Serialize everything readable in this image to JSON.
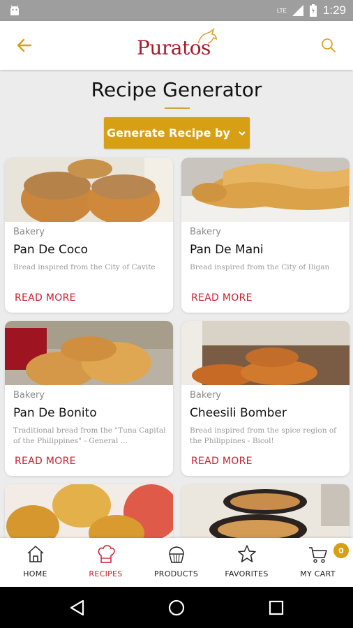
{
  "status_bar": {
    "time": "1:29",
    "network": "LTE"
  },
  "app_bar": {
    "logo": "Puratos"
  },
  "page": {
    "title": "Recipe Generator",
    "generate_button": "Generate Recipe by"
  },
  "recipes": [
    {
      "category": "Bakery",
      "name": "Pan De Coco",
      "description": "Bread inspired from the City of Cavite",
      "action": "READ MORE"
    },
    {
      "category": "Bakery",
      "name": "Pan De Mani",
      "description": "Bread inspired from the City of Iligan",
      "action": "READ MORE"
    },
    {
      "category": "Bakery",
      "name": "Pan De Bonito",
      "description": "Traditional bread from the \"Tuna Capital of the Philippines\" - General ...",
      "action": "READ MORE"
    },
    {
      "category": "Bakery",
      "name": "Cheesili Bomber",
      "description": "Bread inspired from the spice region of the Philippines - Bicol!",
      "action": "READ MORE"
    }
  ],
  "bottom_nav": {
    "items": [
      {
        "label": "HOME",
        "icon": "home-icon"
      },
      {
        "label": "RECIPES",
        "icon": "chef-hat-icon"
      },
      {
        "label": "PRODUCTS",
        "icon": "cupcake-icon"
      },
      {
        "label": "FAVORITES",
        "icon": "star-icon"
      },
      {
        "label": "MY CART",
        "icon": "cart-icon"
      }
    ],
    "active": "RECIPES",
    "cart_count": "0"
  },
  "colors": {
    "accent": "#d69f14",
    "brand": "#a31b2b",
    "link": "#cc1d2e"
  }
}
